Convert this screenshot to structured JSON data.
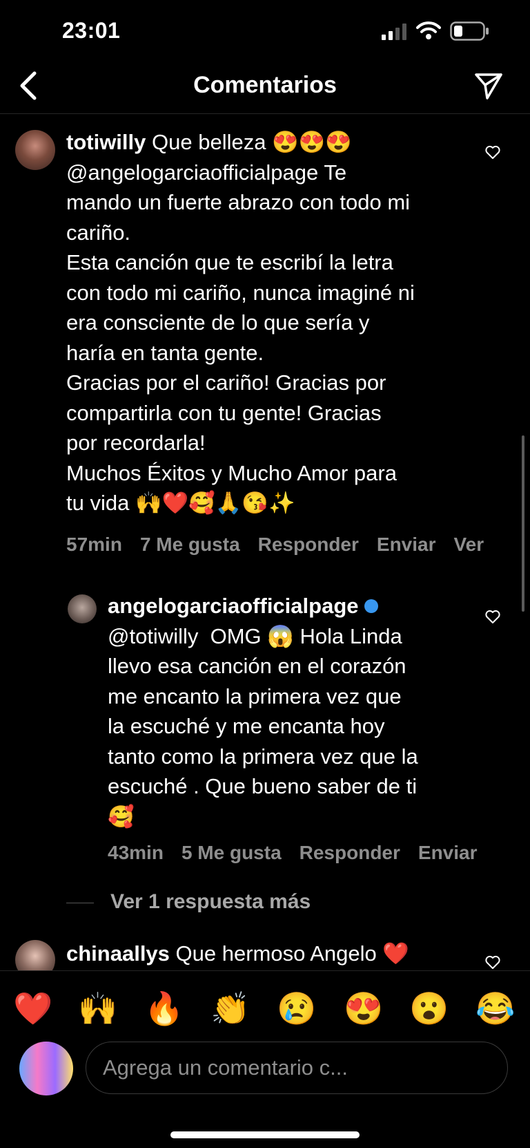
{
  "status_bar": {
    "time": "23:01"
  },
  "header": {
    "title": "Comentarios"
  },
  "comments": [
    {
      "username": "totiwilly",
      "text": " Que belleza 😍😍😍\n@angelogarciaofficialpage Te\nmando un fuerte abrazo con todo mi\ncariño.\nEsta canción que te escribí la letra\ncon todo mi cariño, nunca imaginé ni\nera consciente de lo que sería y\nharía en tanta gente.\nGracias por el cariño! Gracias por\ncompartirla con tu gente! Gracias\npor recordarla!\nMuchos Éxitos y Mucho Amor para\ntu vida 🙌❤️🥰🙏😘✨",
      "time": "57min",
      "likes": "7 Me gusta",
      "reply": "Responder",
      "send": "Enviar",
      "translate": "Ver"
    },
    {
      "username": "angelogarciaofficialpage",
      "text": "@totiwilly  OMG 😱 Hola Linda\nllevo esa canción en el corazón\nme encanto la primera vez que\nla escuché y me encanta hoy\ntanto como la primera vez que la\nescuché . Que bueno saber de ti\n🥰",
      "time": "43min",
      "likes": "5 Me gusta",
      "reply": "Responder",
      "send": "Enviar"
    },
    {
      "username": "chinaallys",
      "text": " Que hermoso Angelo ❤️"
    }
  ],
  "view_more_replies": "Ver 1 respuesta más",
  "emoji_bar": [
    "❤️",
    "🙌",
    "🔥",
    "👏",
    "😢",
    "😍",
    "😮",
    "😂"
  ],
  "composer": {
    "placeholder": "Agrega un comentario c..."
  }
}
